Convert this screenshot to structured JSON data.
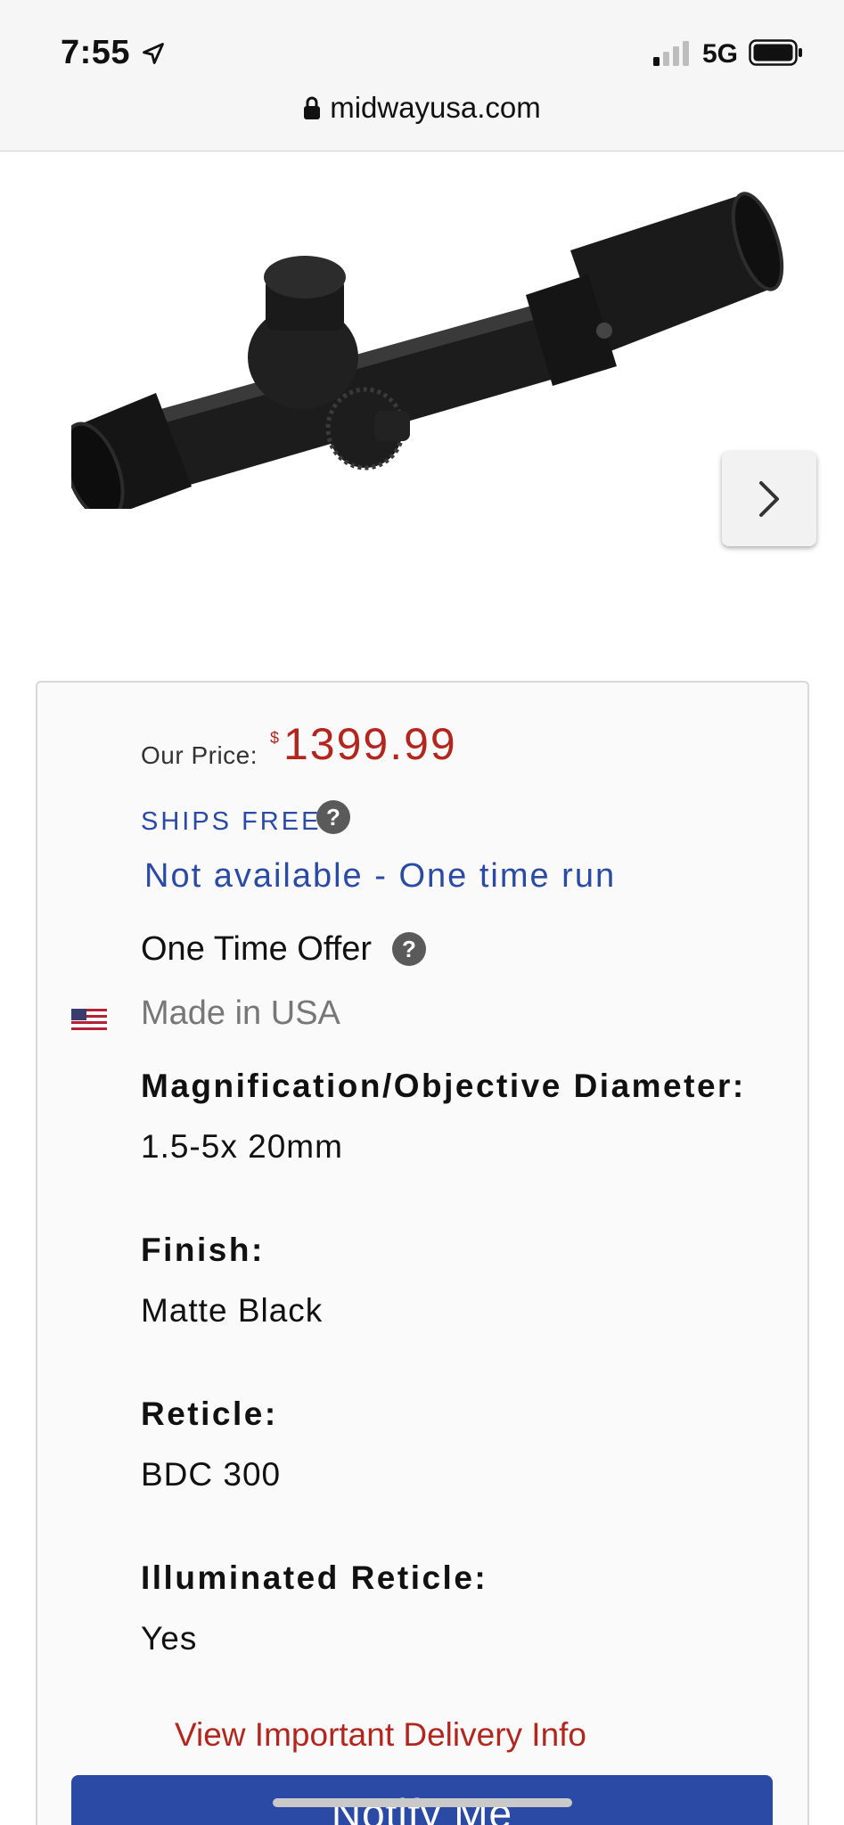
{
  "status_bar": {
    "time": "7:55",
    "network": "5G"
  },
  "browser": {
    "url": "midwayusa.com"
  },
  "product": {
    "price_label": "Our Price:",
    "currency_symbol": "$",
    "price": "1399.99",
    "shipping": "SHIPS FREE",
    "availability": "Not available - One time run",
    "offer": "One Time Offer",
    "origin": "Made in USA",
    "specs": [
      {
        "label": "Magnification/Objective Diameter:",
        "value": "1.5-5x 20mm"
      },
      {
        "label": "Finish:",
        "value": "Matte Black"
      },
      {
        "label": "Reticle:",
        "value": "BDC 300"
      },
      {
        "label": "Illuminated Reticle:",
        "value": "Yes"
      }
    ],
    "delivery_link": "View Important Delivery Info",
    "notify_button": "Notify Me"
  },
  "colors": {
    "price": "#b3261e",
    "accent_blue": "#2a4aa5"
  }
}
